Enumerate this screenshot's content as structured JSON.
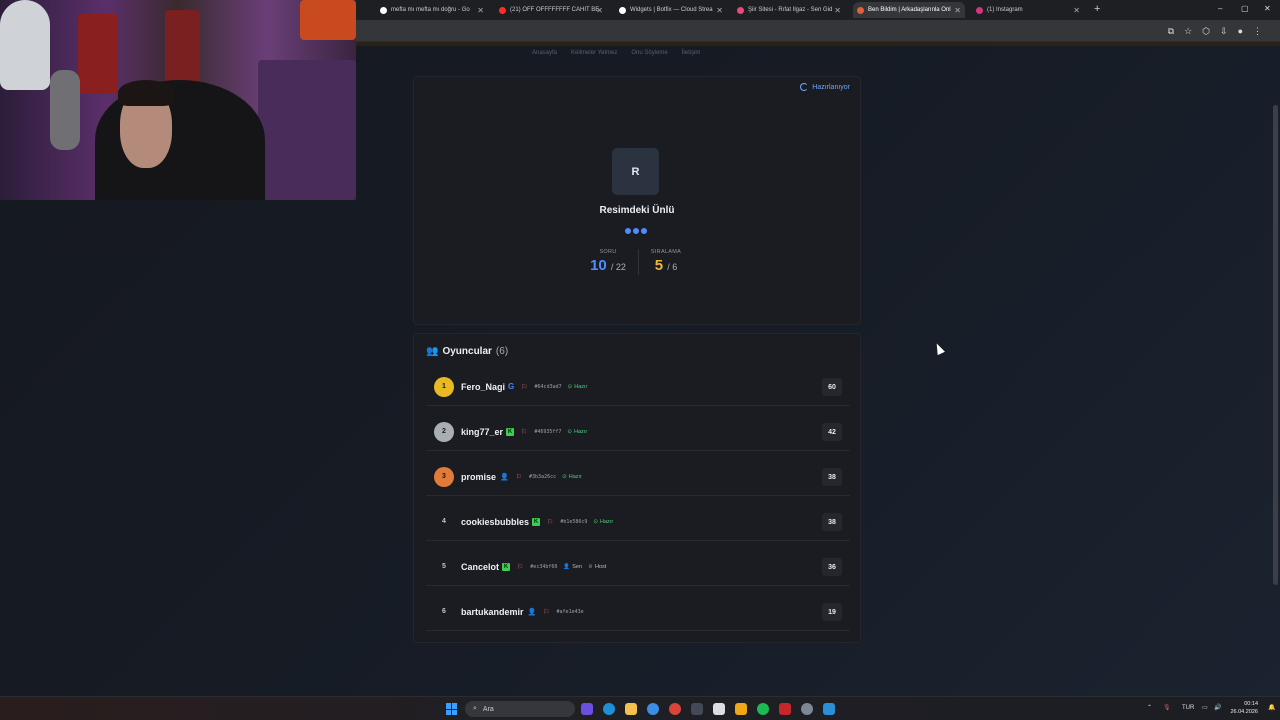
{
  "browser": {
    "tabs": [
      {
        "title": "mefta mı mefta mı doğru - Go",
        "color": "#ffffff"
      },
      {
        "title": "(21) OFF OFFFFFFFF CAHIT BE",
        "color": "#ff2b2b"
      },
      {
        "title": "Widgets | Botfix — Cloud Strea",
        "color": "#ffffff"
      },
      {
        "title": "Şiir Sitesi - Rıfat Ilgaz - Sen Gid",
        "color": "#e84a7a"
      },
      {
        "title": "Ben Bildim | Arkadaşlarınla Onl",
        "color": "#e0603a"
      },
      {
        "title": "(1) Instagram",
        "color": "#d8317f"
      }
    ],
    "new_tab": "+",
    "window_controls": {
      "minimize": "–",
      "maximize": "▢",
      "close": "✕"
    }
  },
  "site": {
    "nav": [
      "Anasayfa",
      "Kelimeler Yetmez",
      "Onu Söyleme",
      "İletişim"
    ]
  },
  "game": {
    "status": "Hazırlanıyor",
    "avatar_letter": "R",
    "title": "Resimdeki Ünlü",
    "question": {
      "label": "SORU",
      "current": "10",
      "total": "/ 22",
      "color": "#4f8cff"
    },
    "rank": {
      "label": "SIRALAMA",
      "current": "5",
      "total": "/ 6",
      "color": "#f2b632"
    }
  },
  "players": {
    "title": "Oyuncular",
    "count": "(6)",
    "list": [
      {
        "rank": "1",
        "name": "Fero_Nagi",
        "auth": "G",
        "id": "#64cd3ad7",
        "tag": "Hazır",
        "tag_type": "ready",
        "score": "60",
        "medal": "#e8b923"
      },
      {
        "rank": "2",
        "name": "king77_er",
        "auth": "K",
        "id": "#46935ff7",
        "tag": "Hazır",
        "tag_type": "ready",
        "score": "42",
        "medal": "#a9adb5"
      },
      {
        "rank": "3",
        "name": "promise",
        "auth": "U",
        "id": "#3b3a26cc",
        "tag": "Hazır",
        "tag_type": "ready",
        "score": "38",
        "medal": "#e07b39"
      },
      {
        "rank": "4",
        "name": "cookiesbubbles",
        "auth": "K",
        "id": "#b1e586c9",
        "tag": "Hazır",
        "tag_type": "ready",
        "score": "38",
        "medal": ""
      },
      {
        "rank": "5",
        "name": "Cancelot",
        "auth": "K",
        "id": "#ec34bf60",
        "tag": "Sen",
        "tag_type": "self",
        "tag2": "Host",
        "score": "36",
        "medal": ""
      },
      {
        "rank": "6",
        "name": "bartukandemir",
        "auth": "U",
        "id": "#afe1e43e",
        "tag": "",
        "tag_type": "",
        "score": "19",
        "medal": ""
      }
    ]
  },
  "taskbar": {
    "search_placeholder": "Ara",
    "language": "TUR",
    "time": "00:14",
    "date": "26.04.2026"
  }
}
